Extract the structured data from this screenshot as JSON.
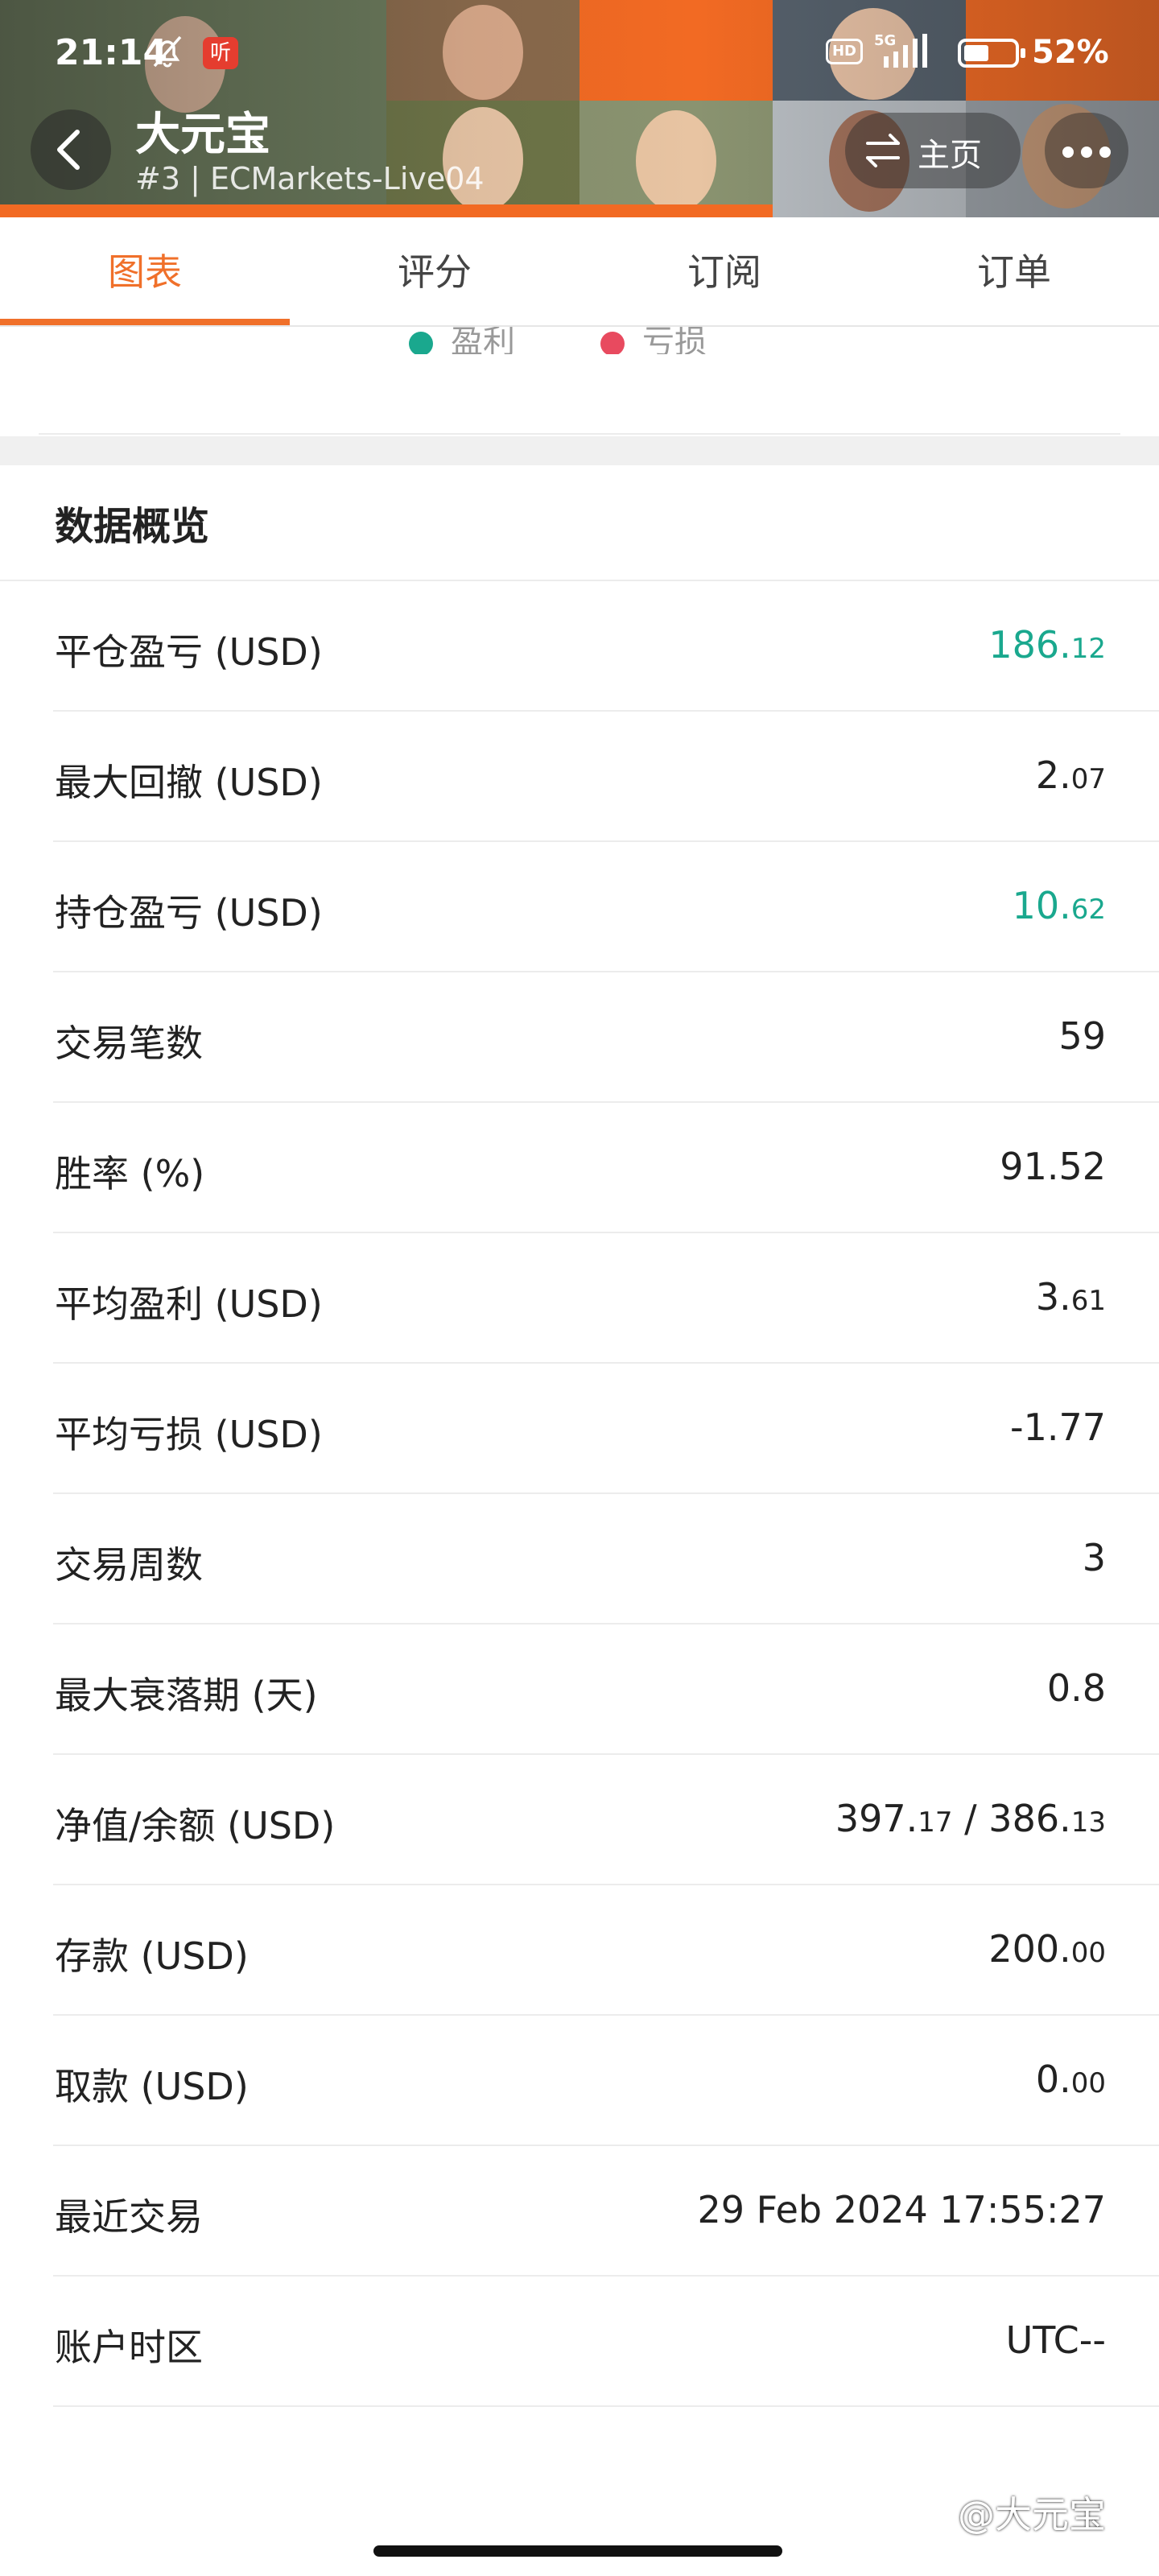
{
  "status_bar": {
    "time": "21:14",
    "app_badge": "听",
    "hd_label": "HD",
    "network": "5G",
    "battery": "52%"
  },
  "header": {
    "back_icon": "chevron-left-icon",
    "title": "大元宝",
    "subtitle": "#3 | ECMarkets-Live04",
    "home_label": "主页",
    "home_icon": "switch-arrows-icon",
    "more_icon": "more-dots-icon",
    "accent_color": "#f0702a"
  },
  "tabs": [
    {
      "label": "图表",
      "active": true
    },
    {
      "label": "评分",
      "active": false
    },
    {
      "label": "订阅",
      "active": false
    },
    {
      "label": "订单",
      "active": false
    }
  ],
  "legend": {
    "profit_label": "盈利",
    "profit_color": "#1aa88e",
    "loss_label": "亏损",
    "loss_color": "#e84a5f"
  },
  "overview": {
    "title": "数据概览",
    "rows": [
      {
        "label": "平仓盈亏 (USD)",
        "value": "186.12",
        "int": "186.",
        "dec": "12",
        "color": "green"
      },
      {
        "label": "最大回撤 (USD)",
        "value": "2.07",
        "int": "2.",
        "dec": "07",
        "color": "default"
      },
      {
        "label": "持仓盈亏 (USD)",
        "value": "10.62",
        "int": "10.",
        "dec": "62",
        "color": "green"
      },
      {
        "label": "交易笔数",
        "value": "59",
        "int": "59",
        "dec": "",
        "color": "default"
      },
      {
        "label": "胜率 (%)",
        "value": "91.52",
        "int": "91.52",
        "dec": "",
        "color": "default"
      },
      {
        "label": "平均盈利 (USD)",
        "value": "3.61",
        "int": "3.",
        "dec": "61",
        "color": "default"
      },
      {
        "label": "平均亏损 (USD)",
        "value": "-1.77",
        "int": "-1.77",
        "dec": "",
        "color": "default"
      },
      {
        "label": "交易周数",
        "value": "3",
        "int": "3",
        "dec": "",
        "color": "default"
      },
      {
        "label": "最大衰落期 (天)",
        "value": "0.8",
        "int": "0.8",
        "dec": "",
        "color": "default"
      },
      {
        "label": "净值/余额 (USD)",
        "value": "397.17 / 386.13",
        "int": "397.",
        "dec": "17",
        "int2": " / 386.",
        "dec2": "13",
        "color": "default"
      },
      {
        "label": "存款 (USD)",
        "value": "200.00",
        "int": "200.",
        "dec": "00",
        "color": "default"
      },
      {
        "label": "取款 (USD)",
        "value": "0.00",
        "int": "0.",
        "dec": "00",
        "color": "default"
      },
      {
        "label": "最近交易",
        "value": "29 Feb 2024 17:55:27",
        "int": "29 Feb 2024 17:55:27",
        "dec": "",
        "color": "default"
      },
      {
        "label": "账户时区",
        "value": "UTC--",
        "int": "UTC--",
        "dec": "",
        "color": "default"
      }
    ]
  },
  "watermark": "@大元宝"
}
